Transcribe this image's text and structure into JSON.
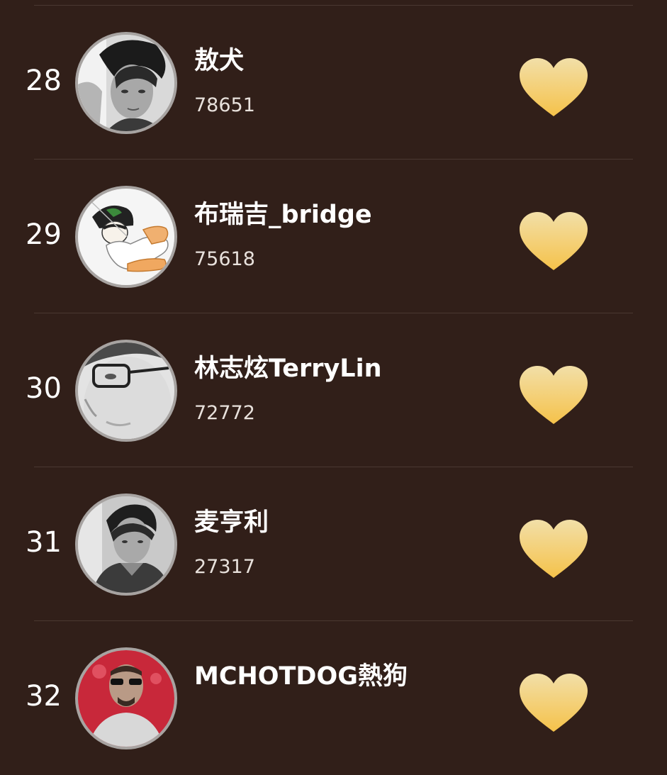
{
  "ranking": {
    "items": [
      {
        "rank": "28",
        "name": "敖犬",
        "score": "78651",
        "avatar": "portrait-dark-hair-man-grayscale"
      },
      {
        "rank": "29",
        "name": "布瑞吉_bridge",
        "score": "75618",
        "avatar": "cartoon-character-illustration"
      },
      {
        "rank": "30",
        "name": "林志炫TerryLin",
        "score": "72772",
        "avatar": "portrait-man-glasses-closeup"
      },
      {
        "rank": "31",
        "name": "麦亨利",
        "score": "27317",
        "avatar": "portrait-young-man-grayscale"
      },
      {
        "rank": "32",
        "name": "MCHOTDOG熱狗",
        "score": "",
        "avatar": "portrait-man-sunglasses-red-background"
      }
    ],
    "heart_icon": "heart-icon",
    "colors": {
      "background": "#311f19",
      "divider": "#4a3831",
      "heart_top": "#f2dfa8",
      "heart_bottom": "#f5c24a",
      "avatar_border": "#a7a3a1"
    }
  }
}
